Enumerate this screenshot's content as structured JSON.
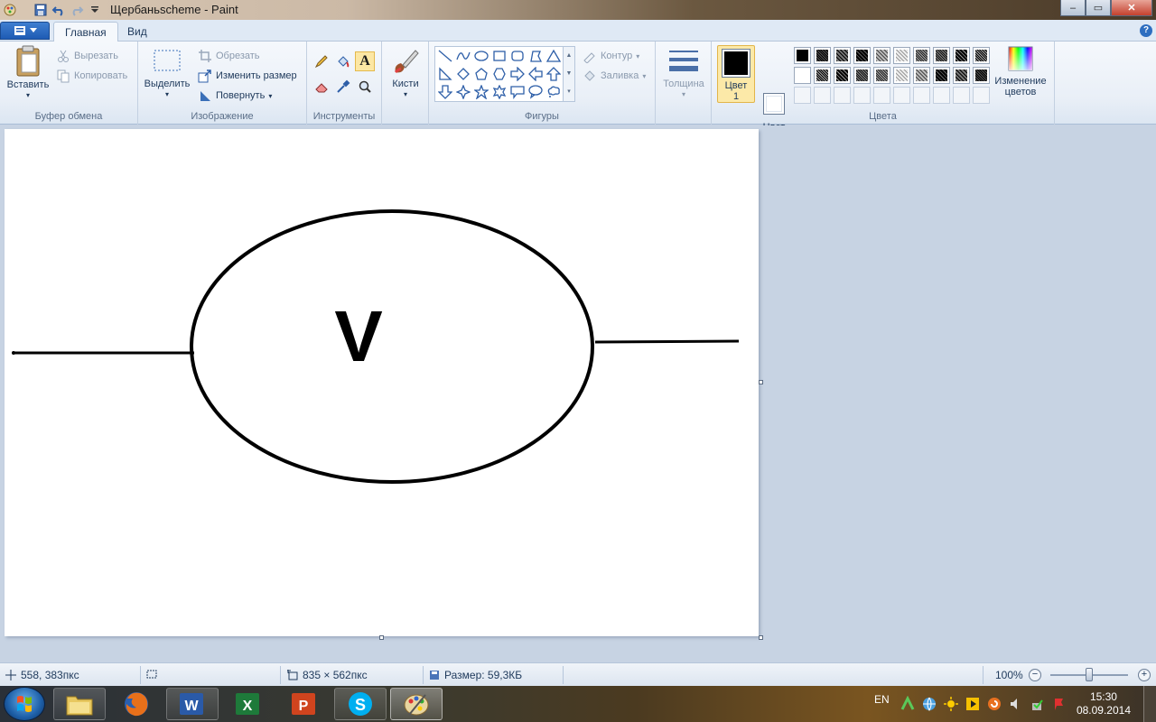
{
  "window": {
    "title": "Щербаньscheme - Paint",
    "minimize_label": "–",
    "maximize_label": "▭",
    "close_label": "✕"
  },
  "tabs": {
    "home": "Главная",
    "view": "Вид"
  },
  "help_label": "?",
  "ribbon": {
    "clipboard": {
      "label": "Буфер обмена",
      "paste": "Вставить",
      "cut": "Вырезать",
      "copy": "Копировать"
    },
    "image": {
      "label": "Изображение",
      "select": "Выделить",
      "crop": "Обрезать",
      "resize": "Изменить размер",
      "rotate": "Повернуть"
    },
    "tools": {
      "label": "Инструменты",
      "text_tool": "A"
    },
    "brushes": {
      "label": "Кисти"
    },
    "shapes": {
      "label": "Фигуры",
      "outline": "Контур",
      "fill": "Заливка"
    },
    "size": {
      "label": "Толщина"
    },
    "colors": {
      "label": "Цвета",
      "color1_line1": "Цвет",
      "color1_line2": "1",
      "color2_line1": "Цвет",
      "color2_line2": "2",
      "edit_line1": "Изменение",
      "edit_line2": "цветов",
      "color1_value": "#000000",
      "color2_value": "#ffffff"
    }
  },
  "drawing": {
    "letter": "V"
  },
  "statusbar": {
    "cursor_pos": "558, 383пкс",
    "image_size": "835 × 562пкс",
    "file_size": "Размер: 59,3КБ",
    "zoom": "100%",
    "zoom_minus": "−",
    "zoom_plus": "+"
  },
  "taskbar": {
    "lang": "EN",
    "time": "15:30",
    "date": "08.09.2014"
  }
}
